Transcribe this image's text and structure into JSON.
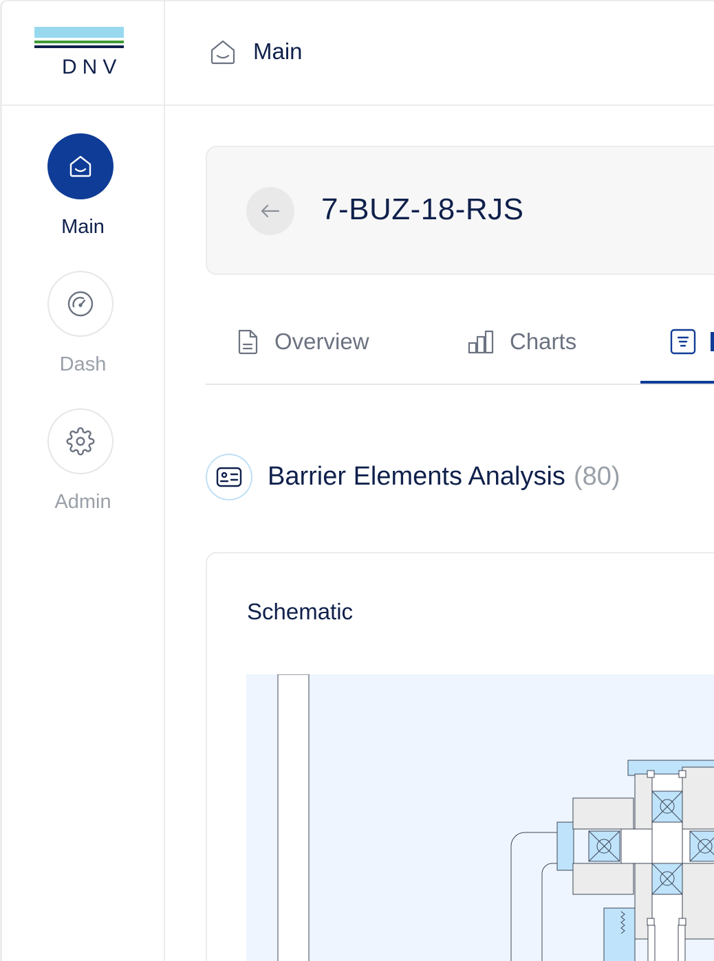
{
  "brand": {
    "logo_text": "DNV",
    "colors": {
      "light_blue": "#99d9f0",
      "green": "#3f9c35",
      "navy": "#0f204b",
      "accent": "#0f3c96"
    }
  },
  "sidebar": {
    "items": [
      {
        "label": "Main",
        "icon": "home-icon",
        "active": true
      },
      {
        "label": "Dash",
        "icon": "gauge-icon",
        "active": false
      },
      {
        "label": "Admin",
        "icon": "gear-icon",
        "active": false
      }
    ]
  },
  "header": {
    "title": "Main",
    "icon": "home-icon"
  },
  "page": {
    "title": "7-BUZ-18-RJS",
    "back_icon": "arrow-left-icon"
  },
  "tabs": [
    {
      "label": "Overview",
      "icon": "document-icon",
      "active": false
    },
    {
      "label": "Charts",
      "icon": "bar-chart-icon",
      "active": false
    },
    {
      "label": "",
      "icon": "list-icon",
      "active": true
    }
  ],
  "section": {
    "title": "Barrier Elements Analysis",
    "count": "(80)",
    "icon": "id-card-icon"
  },
  "schematic": {
    "title": "Schematic"
  }
}
